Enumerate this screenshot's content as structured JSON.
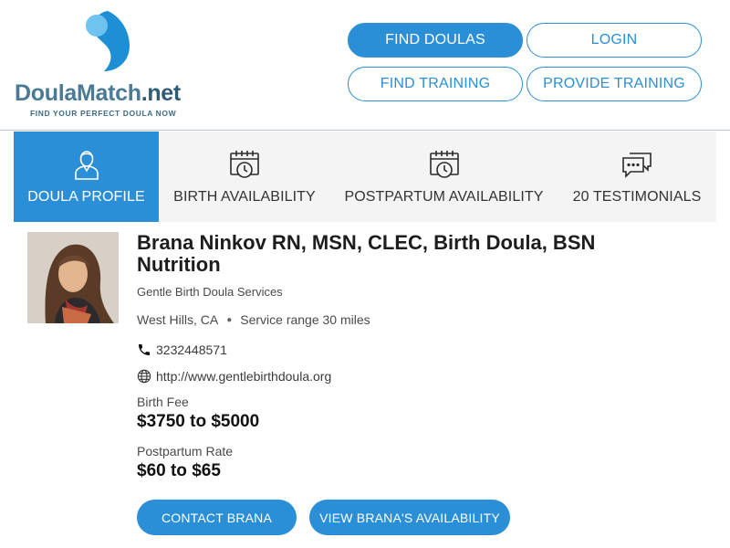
{
  "brand": {
    "logo_doula": "Doula",
    "logo_match": "Match",
    "logo_net": ".net",
    "tagline": "FIND YOUR PERFECT DOULA NOW",
    "colors": {
      "primary": "#2a8fd6",
      "logo_blue": "#4a7a94",
      "drop_light": "#6fc3ef",
      "drop_dark": "#1e8fd5"
    }
  },
  "nav": {
    "find_doulas": "FIND DOULAS",
    "login": "LOGIN",
    "find_training": "FIND TRAINING",
    "provide_training": "PROVIDE TRAINING"
  },
  "tabs": [
    {
      "label": "DOULA PROFILE",
      "icon": "person-icon",
      "active": true
    },
    {
      "label": "BIRTH AVAILABILITY",
      "icon": "calendar-clock-icon",
      "active": false
    },
    {
      "label": "POSTPARTUM AVAILABILITY",
      "icon": "calendar-clock-icon",
      "active": false
    },
    {
      "label": "20 TESTIMONIALS",
      "icon": "chat-bubbles-icon",
      "active": false
    }
  ],
  "profile": {
    "name": "Brana Ninkov RN, MSN, CLEC, Birth Doula, BSN Nutrition",
    "company": "Gentle Birth Doula Services",
    "city": "West Hills, CA",
    "service_range": "Service range 30 miles",
    "phone": "3232448571",
    "website": "http://www.gentlebirthdoula.org",
    "birth_fee_label": "Birth Fee",
    "birth_fee_value": "$3750 to $5000",
    "postpartum_label": "Postpartum Rate",
    "postpartum_value": "$60 to $65"
  },
  "actions": {
    "contact": "CONTACT BRANA",
    "availability": "VIEW BRANA'S AVAILABILITY"
  }
}
